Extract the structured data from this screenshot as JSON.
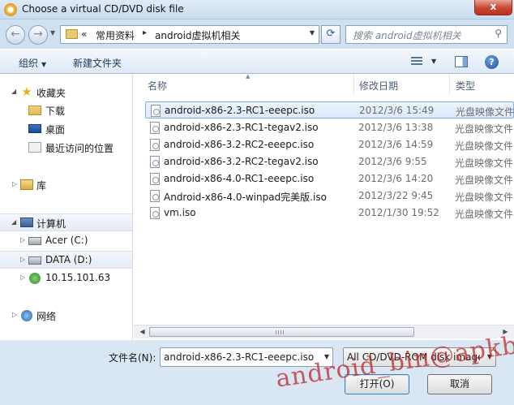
{
  "window": {
    "title": "Choose a virtual CD/DVD disk file",
    "close_glyph": "x"
  },
  "nav": {
    "back_glyph": "←",
    "forward_glyph": "→",
    "address_prefix": "«",
    "address_parts": [
      "常用资料",
      "android虚拟机相关"
    ],
    "separator": "▸",
    "search_placeholder": "搜索 android虚拟机相关"
  },
  "toolbar": {
    "organize": "组织",
    "new_folder": "新建文件夹",
    "help_glyph": "?"
  },
  "navpane": {
    "favorites": "收藏夹",
    "downloads": "下载",
    "desktop": "桌面",
    "recent": "最近访问的位置",
    "libraries": "库",
    "computer": "计算机",
    "drive_c": "Acer (C:)",
    "drive_d": "DATA (D:)",
    "network_drive": "10.15.101.63",
    "network": "网络"
  },
  "columns": {
    "name": "名称",
    "date": "修改日期",
    "type": "类型"
  },
  "files": [
    {
      "name": "android-x86-2.3-RC1-eeepc.iso",
      "date": "2012/3/6 15:49",
      "type": "光盘映像文件",
      "selected": true
    },
    {
      "name": "android-x86-2.3-RC1-tegav2.iso",
      "date": "2012/3/6 13:38",
      "type": "光盘映像文件",
      "selected": false
    },
    {
      "name": "android-x86-3.2-RC2-eeepc.iso",
      "date": "2012/3/6 14:59",
      "type": "光盘映像文件",
      "selected": false
    },
    {
      "name": "android-x86-3.2-RC2-tegav2.iso",
      "date": "2012/3/6 9:55",
      "type": "光盘映像文件",
      "selected": false
    },
    {
      "name": "android-x86-4.0-RC1-eeepc.iso",
      "date": "2012/3/6 14:20",
      "type": "光盘映像文件",
      "selected": false
    },
    {
      "name": "Android-x86-4.0-winpad完美版.iso",
      "date": "2012/3/22 9:45",
      "type": "光盘映像文件",
      "selected": false
    },
    {
      "name": "vm.iso",
      "date": "2012/1/30 19:52",
      "type": "光盘映像文件",
      "selected": false
    }
  ],
  "bottom": {
    "filename_label": "文件名(N):",
    "filename_value": "android-x86-2.3-RC1-eeepc.iso",
    "filter_value": "All CD/DVD-ROM disk images",
    "open_button": "打开(O)",
    "cancel_button": "取消"
  },
  "watermark": "android_bin@apkbus",
  "colors": {
    "selection_border": "#84acdd",
    "close_button": "#c9452d",
    "watermark": "#be2828"
  }
}
